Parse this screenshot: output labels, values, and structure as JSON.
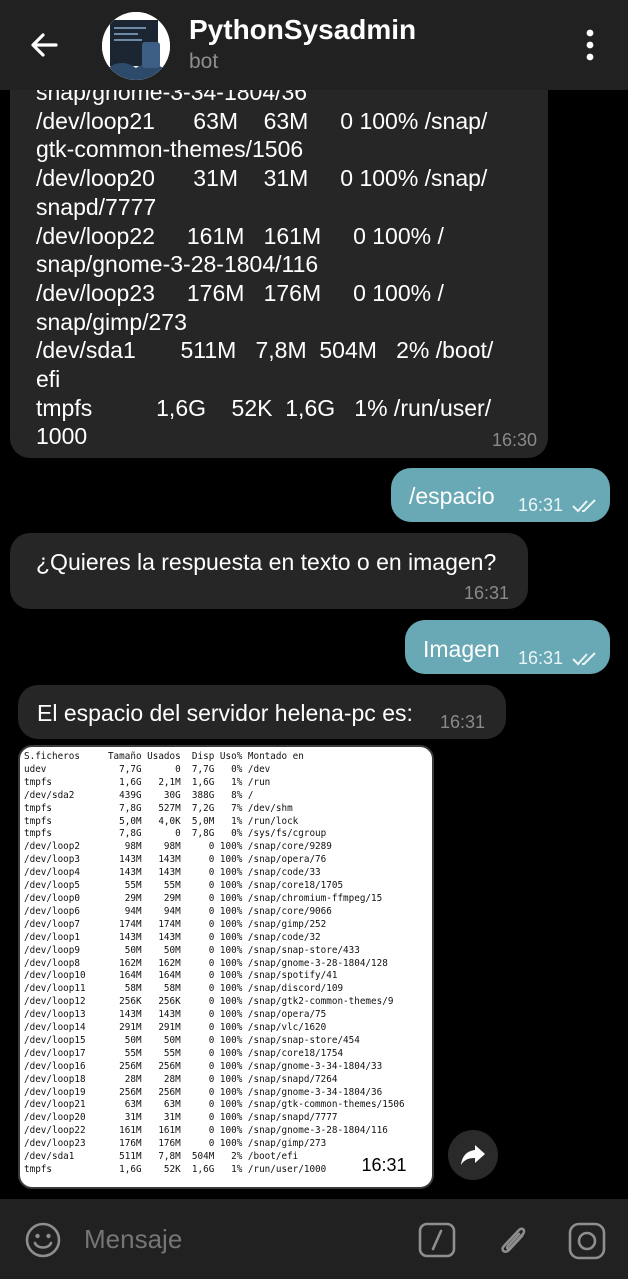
{
  "header": {
    "title": "PythonSysadmin",
    "subtitle": "bot"
  },
  "messages": {
    "df_partial": {
      "lines": [
        "snap/gnome-3-34-1804/36",
        "/dev/loop21      63M    63M     0 100% /snap/",
        "gtk-common-themes/1506",
        "/dev/loop20      31M    31M     0 100% /snap/",
        "snapd/7777",
        "/dev/loop22     161M   161M     0 100% /",
        "snap/gnome-3-28-1804/116",
        "/dev/loop23     176M   176M     0 100% /",
        "snap/gimp/273",
        "/dev/sda1       511M   7,8M  504M   2% /boot/",
        "efi",
        "tmpfs          1,6G    52K  1,6G   1% /run/user/",
        "1000"
      ],
      "time": "16:30"
    },
    "out1": {
      "text": "/espacio",
      "time": "16:31"
    },
    "in1": {
      "text": "¿Quieres la respuesta en texto o en imagen?",
      "time": "16:31"
    },
    "out2": {
      "text": "Imagen",
      "time": "16:31"
    },
    "in2": {
      "text": "El espacio del servidor helena-pc es:",
      "time": "16:31"
    },
    "image": {
      "time": "16:31",
      "rows": [
        "S.ficheros     Tamaño Usados  Disp Uso% Montado en",
        "udev             7,7G      0  7,7G   0% /dev",
        "tmpfs            1,6G   2,1M  1,6G   1% /run",
        "/dev/sda2        439G    30G  388G   8% /",
        "tmpfs            7,8G   527M  7,2G   7% /dev/shm",
        "tmpfs            5,0M   4,0K  5,0M   1% /run/lock",
        "tmpfs            7,8G      0  7,8G   0% /sys/fs/cgroup",
        "/dev/loop2        98M    98M     0 100% /snap/core/9289",
        "/dev/loop3       143M   143M     0 100% /snap/opera/76",
        "/dev/loop4       143M   143M     0 100% /snap/code/33",
        "/dev/loop5        55M    55M     0 100% /snap/core18/1705",
        "/dev/loop0        29M    29M     0 100% /snap/chromium-ffmpeg/15",
        "/dev/loop6        94M    94M     0 100% /snap/core/9066",
        "/dev/loop7       174M   174M     0 100% /snap/gimp/252",
        "/dev/loop1       143M   143M     0 100% /snap/code/32",
        "/dev/loop9        50M    50M     0 100% /snap/snap-store/433",
        "/dev/loop8       162M   162M     0 100% /snap/gnome-3-28-1804/128",
        "/dev/loop10      164M   164M     0 100% /snap/spotify/41",
        "/dev/loop11       58M    58M     0 100% /snap/discord/109",
        "/dev/loop12      256K   256K     0 100% /snap/gtk2-common-themes/9",
        "/dev/loop13      143M   143M     0 100% /snap/opera/75",
        "/dev/loop14      291M   291M     0 100% /snap/vlc/1620",
        "/dev/loop15       50M    50M     0 100% /snap/snap-store/454",
        "/dev/loop17       55M    55M     0 100% /snap/core18/1754",
        "/dev/loop16      256M   256M     0 100% /snap/gnome-3-34-1804/33",
        "/dev/loop18       28M    28M     0 100% /snap/snapd/7264",
        "/dev/loop19      256M   256M     0 100% /snap/gnome-3-34-1804/36",
        "/dev/loop21       63M    63M     0 100% /snap/gtk-common-themes/1506",
        "/dev/loop20       31M    31M     0 100% /snap/snapd/7777",
        "/dev/loop22      161M   161M     0 100% /snap/gnome-3-28-1804/116",
        "/dev/loop23      176M   176M     0 100% /snap/gimp/273",
        "/dev/sda1        511M   7,8M  504M   2% /boot/efi",
        "tmpfs            1,6G    52K  1,6G   1% /run/user/1000"
      ]
    }
  },
  "composer": {
    "placeholder": "Mensaje"
  },
  "colors": {
    "background": "#000000",
    "bar": "#212121",
    "incoming_bubble": "#262626",
    "outgoing_bubble": "#69a8b5"
  },
  "icons": [
    "back-arrow-icon",
    "more-vertical-icon",
    "emoji-icon",
    "bot-command-icon",
    "paperclip-icon",
    "camera-icon",
    "share-icon",
    "double-check-icon"
  ]
}
